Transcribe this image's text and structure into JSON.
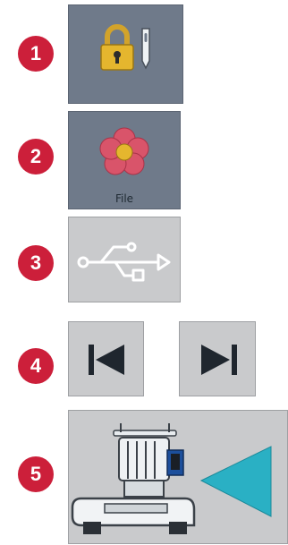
{
  "steps": [
    {
      "number": "1",
      "icon": "lock-needle-icon"
    },
    {
      "number": "2",
      "icon": "flower-icon",
      "label": "File"
    },
    {
      "number": "3",
      "icon": "usb-icon"
    },
    {
      "number": "4",
      "icons": [
        "skip-first-icon",
        "skip-last-icon"
      ]
    },
    {
      "number": "5",
      "icon": "embroidery-machine-icon"
    }
  ],
  "colors": {
    "badge": "#cc1f3a",
    "dark_button": "#6f7a8a",
    "light_button": "#c9cacc",
    "arrow": "#2ab0c4",
    "flower_petal": "#d9546a",
    "lock_gold": "#e5b62e"
  }
}
